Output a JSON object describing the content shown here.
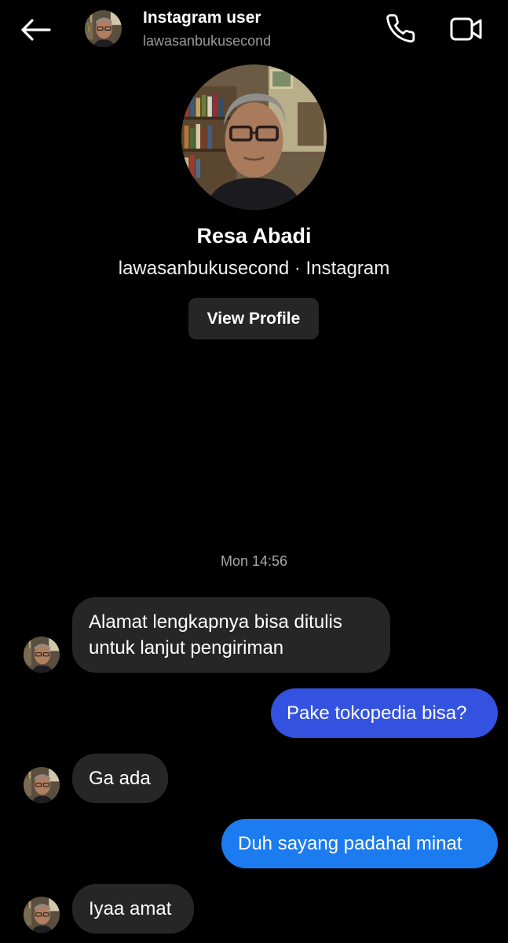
{
  "header": {
    "title": "Instagram user",
    "subtitle": "lawasanbukusecond",
    "icons": {
      "back": "arrow-left-icon",
      "call": "phone-icon",
      "video": "video-camera-icon"
    }
  },
  "profile": {
    "name": "Resa Abadi",
    "subtitle": "lawasanbukusecond · Instagram",
    "view_profile_label": "View Profile"
  },
  "chat": {
    "timestamp": "Mon 14:56",
    "messages": [
      {
        "direction": "in",
        "lines": [
          "Alamat lengkapnya bisa ditulis",
          "untuk lanjut pengiriman"
        ]
      },
      {
        "direction": "out",
        "lines": [
          "Pake tokopedia bisa?"
        ]
      },
      {
        "direction": "in",
        "lines": [
          "Ga ada"
        ]
      },
      {
        "direction": "out",
        "lines": [
          "Duh sayang padahal minat"
        ]
      },
      {
        "direction": "in",
        "lines": [
          "Iyaa amat"
        ]
      }
    ]
  },
  "colors": {
    "background": "#000000",
    "incoming_bubble": "#262626",
    "outgoing_bubble_top": "#3355e0",
    "outgoing_bubble_bottom": "#1a7cf0",
    "secondary_text": "#9a9a9a"
  }
}
